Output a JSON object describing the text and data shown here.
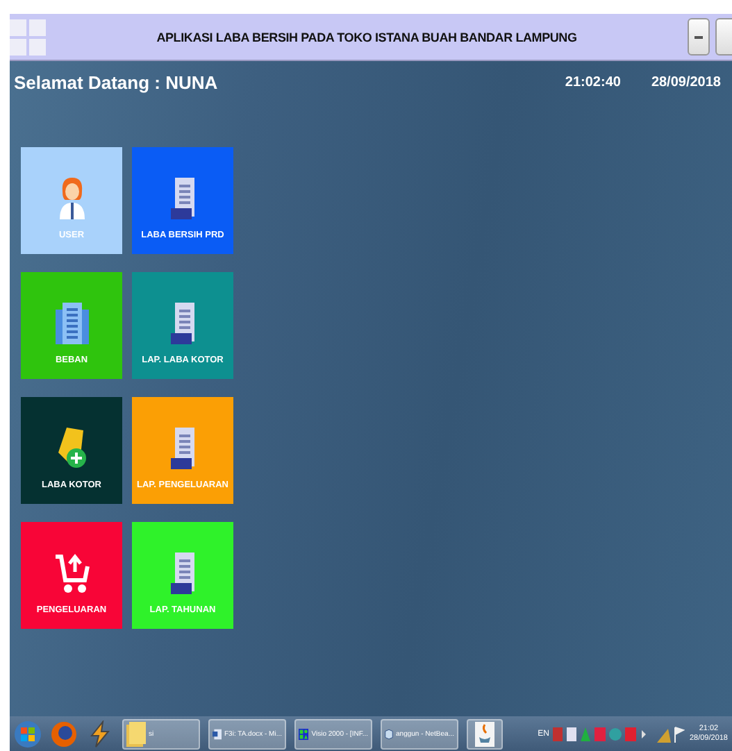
{
  "window": {
    "title": "APLIKASI LABA BERSIH PADA TOKO ISTANA BUAH BANDAR LAMPUNG"
  },
  "header": {
    "greeting": "Selamat Datang :  NUNA",
    "time": "21:02:40",
    "date": "28/09/2018"
  },
  "tiles": [
    {
      "label": "USER",
      "kind": "person",
      "color": "#a9d2fb"
    },
    {
      "label": "LABA BERSIH PRD",
      "kind": "document",
      "color": "#0a5cf5"
    },
    {
      "label": "BEBAN",
      "kind": "building",
      "color": "#2fc40d"
    },
    {
      "label": "LAP. LABA KOTOR",
      "kind": "document",
      "color": "#0d9090"
    },
    {
      "label": "LABA KOTOR",
      "kind": "tag",
      "color": "#053131"
    },
    {
      "label": "LAP. PENGELUARAN",
      "kind": "document",
      "color": "#fb9f05"
    },
    {
      "label": "PENGELUARAN",
      "kind": "cart",
      "color": "#f80537"
    },
    {
      "label": "LAP. TAHUNAN",
      "kind": "document",
      "color": "#2ff22a"
    }
  ],
  "taskbar": {
    "items": [
      {
        "kind": "start"
      },
      {
        "kind": "firefox"
      },
      {
        "kind": "winamp"
      },
      {
        "kind": "folder",
        "label": "si"
      },
      {
        "kind": "word",
        "label": "F3i: TA.docx - Mi..."
      },
      {
        "kind": "visio",
        "label": "Visio 2000 - [INF..."
      },
      {
        "kind": "netbeans",
        "label": "anggun - NetBea..."
      },
      {
        "kind": "java"
      }
    ],
    "language": "EN",
    "clock_time": "21:02",
    "clock_date": "28/09/2018"
  }
}
